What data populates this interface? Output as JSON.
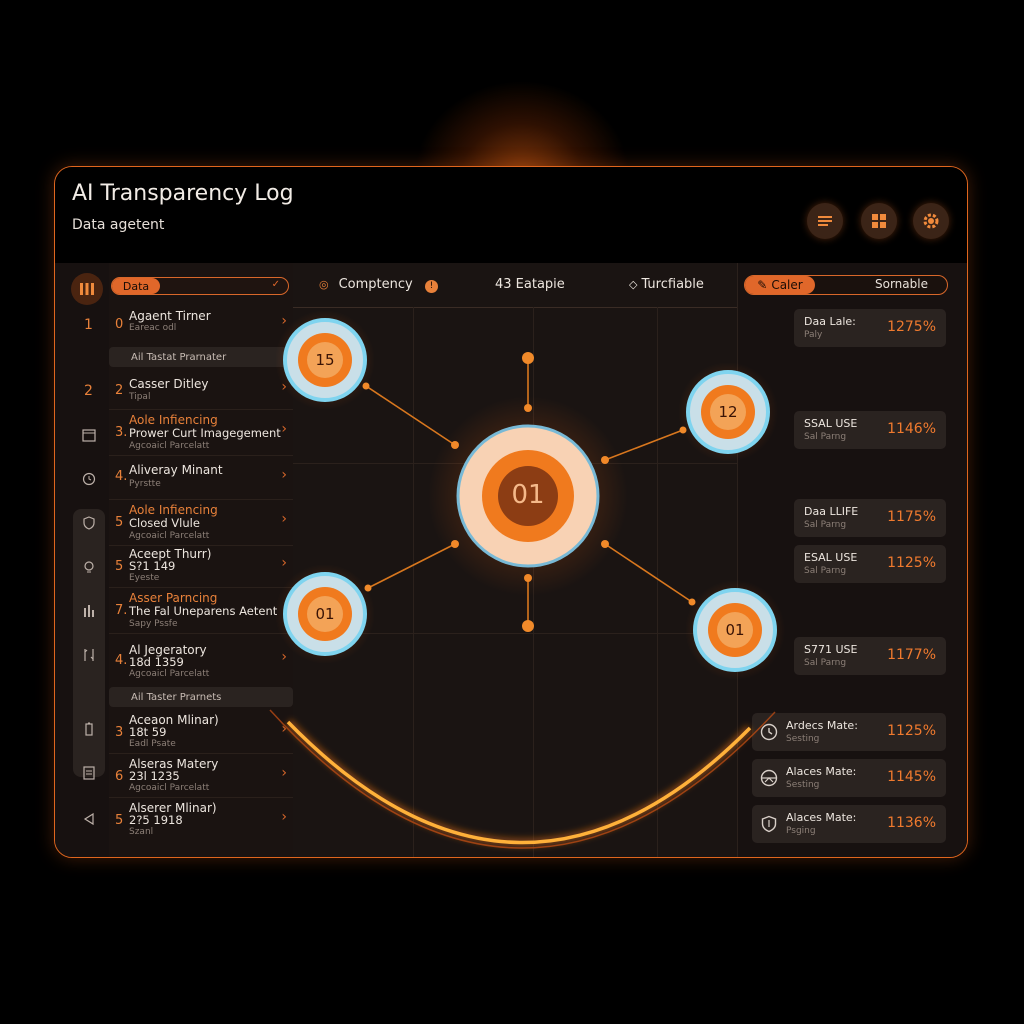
{
  "app": {
    "title": "AI Transparency Log",
    "subtitle": "Data agetent"
  },
  "header_icons": [
    "menu-icon",
    "grid-icon",
    "gear-icon"
  ],
  "rail": {
    "numbers": [
      "1",
      "2"
    ],
    "icons": [
      "calendar-icon",
      "clock-icon",
      "shield-icon",
      "bulb-icon",
      "bars-icon",
      "tools-icon",
      "battery-icon",
      "document-icon",
      "play-back-icon"
    ]
  },
  "list": {
    "filter_label": "Data",
    "section_1": "Ail Tastat Prarnater",
    "section_2": "Ail Taster Prarnets",
    "items": [
      {
        "num": "1",
        "num2": "0",
        "title": "Agaent Tirner",
        "sub": "Eareac odl"
      },
      {
        "num": "2",
        "num2": "2",
        "title": "Casser Ditley",
        "sub": "Tipal"
      },
      {
        "num": "",
        "num2": "3.",
        "title": "Aole Infiencing",
        "title2": "Prower Curt Imagegement",
        "sub": "Agcoaicl Parcelatt"
      },
      {
        "num": "",
        "num2": "4.",
        "title": "Aliveray Minant",
        "sub": "Pyrstte"
      },
      {
        "num": "",
        "num2": "5",
        "title": "Aole Infiencing",
        "title2": "Closed Vlule",
        "sub": "Agcoaicl Parcelatt"
      },
      {
        "num": "",
        "num2": "5",
        "title": "Aceept Thurr)",
        "title2": "S?1 149",
        "sub": "Eyeste"
      },
      {
        "num": "",
        "num2": "7.",
        "title": "Asser Parncing",
        "title2": "The Fal Uneparens Aetent",
        "sub": "Sapy Pssfe"
      },
      {
        "num": "",
        "num2": "4.",
        "title": "Al Jegeratory",
        "title2": "18d 1359",
        "sub": "Agcoaicl Parcelatt"
      },
      {
        "num": "",
        "num2": "3",
        "title": "Aceaon Mlinar)",
        "title2": "18t 59",
        "sub": "Eadl Psate"
      },
      {
        "num": "",
        "num2": "6",
        "title": "Alseras Matery",
        "title2": "23l 1235",
        "sub": "Agcoaicl Parcelatt"
      },
      {
        "num": "",
        "num2": "5",
        "title": "Alserer Mlinar)",
        "title2": "2?5 1918",
        "sub": "Szanl"
      }
    ]
  },
  "tabs": [
    {
      "label": "Comptency",
      "badge": "!"
    },
    {
      "label": "43 Eatapie"
    },
    {
      "label": "Turcfiable"
    }
  ],
  "graph": {
    "center_label": "01",
    "nodes": [
      {
        "label": "15"
      },
      {
        "label": "12"
      },
      {
        "label": "01"
      },
      {
        "label": "01"
      }
    ]
  },
  "right": {
    "toggle_on": "Caler",
    "toggle_off": "Sornable",
    "stats": [
      {
        "label": "Daa Lale:",
        "sub": "Paly",
        "value": "1275%"
      },
      {
        "label": "SSAL USE",
        "sub": "Sal Parng",
        "value": "1146%"
      },
      {
        "label": "Daa LLIFE",
        "sub": "Sal Parng",
        "value": "1175%"
      },
      {
        "label": "ESAL USE",
        "sub": "Sal Parng",
        "value": "1125%"
      },
      {
        "label": "S771 USE",
        "sub": "Sal Parng",
        "value": "1177%"
      },
      {
        "label": "Ardecs Mate:",
        "sub": "Sesting",
        "value": "1125%",
        "icon": "clock-icon"
      },
      {
        "label": "Alaces Mate:",
        "sub": "Sesting",
        "value": "1145%",
        "icon": "globe-icon"
      },
      {
        "label": "Alaces Mate:",
        "sub": "Psging",
        "value": "1136%",
        "icon": "shield-icon"
      }
    ]
  },
  "colors": {
    "accent": "#e8813a",
    "accent_strong": "#f07a2e",
    "node_ring": "#7fd4ef",
    "background": "#000000"
  }
}
